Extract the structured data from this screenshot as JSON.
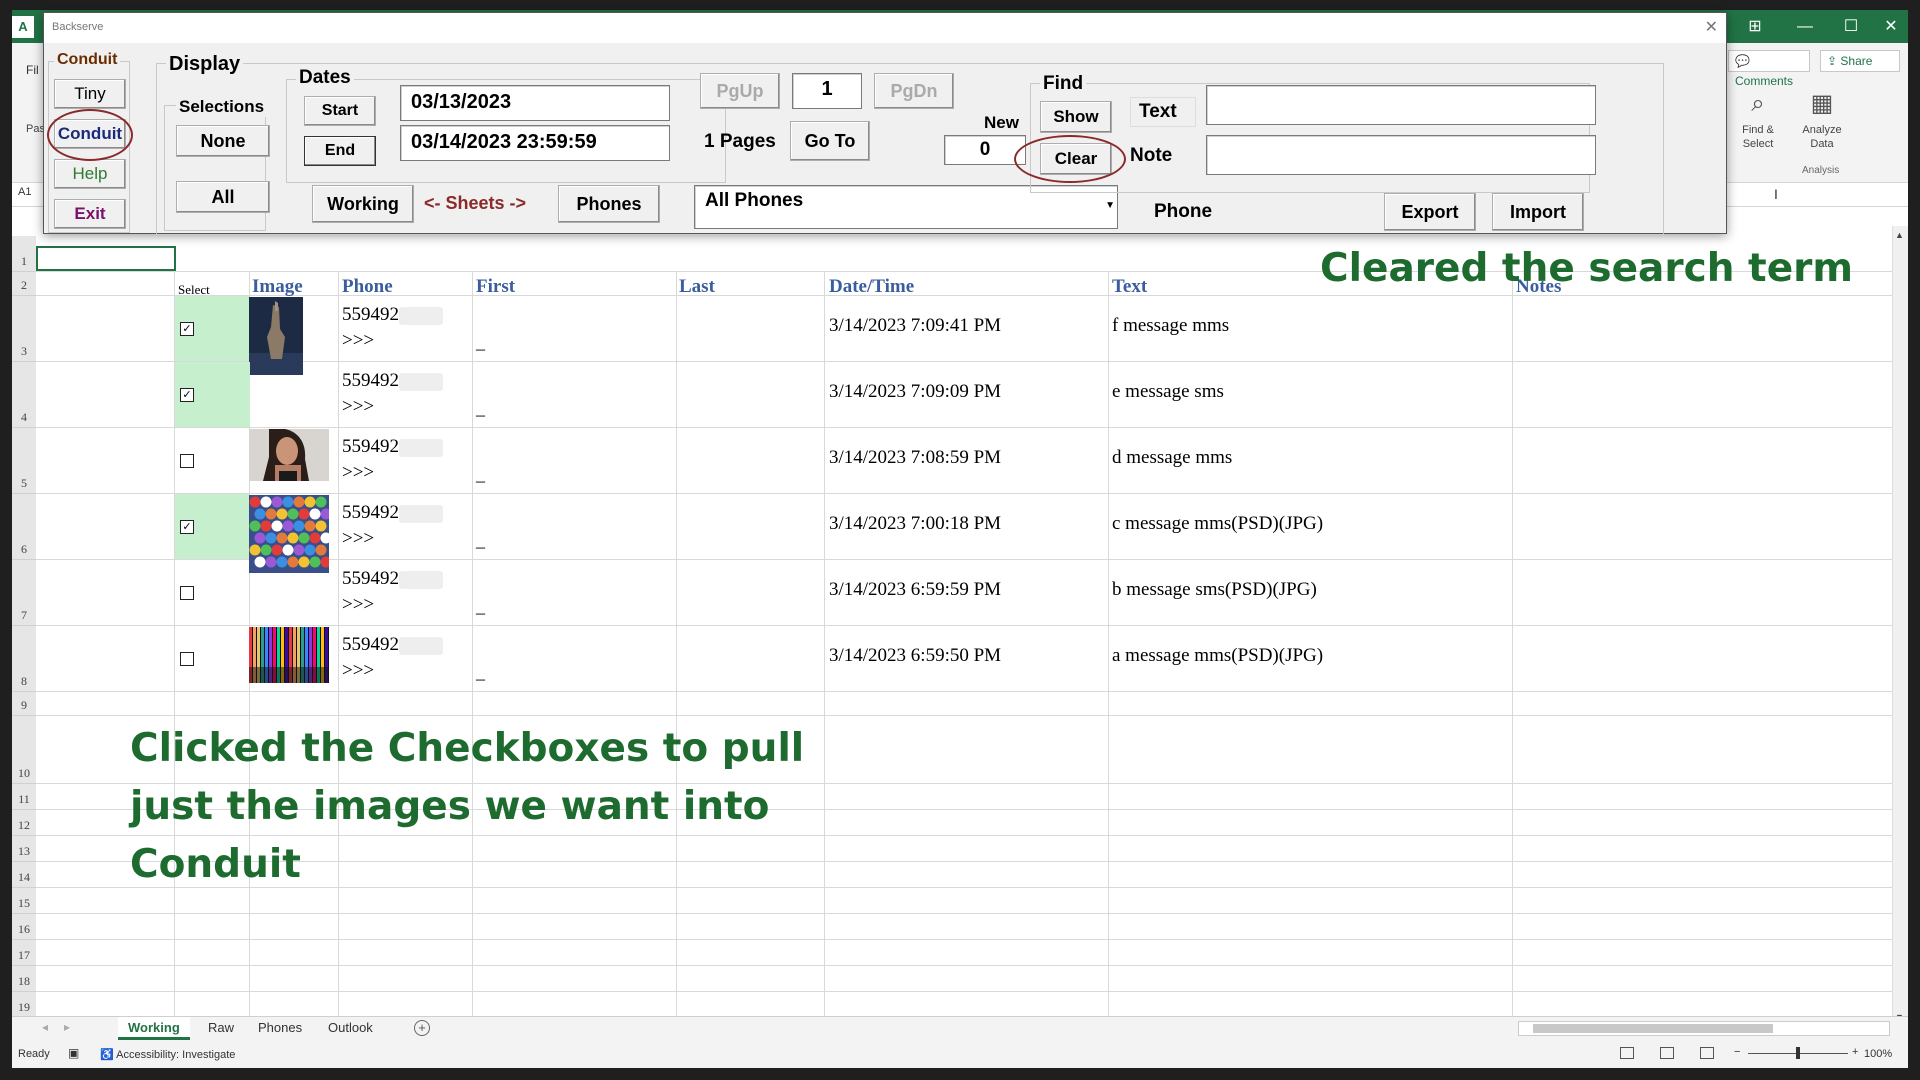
{
  "excel": {
    "app_letter": "A",
    "file_letter": "Fil",
    "paste_letter": "Pas",
    "comments": "Comments",
    "share": "Share",
    "find_select": "Find & Select",
    "analyze_data": "Analyze Data",
    "analysis_group": "Analysis",
    "name_box": "A1",
    "sheet_tabs": [
      "Working",
      "Raw",
      "Phones",
      "Outlook"
    ],
    "active_tab": "Working",
    "status_ready": "Ready",
    "status_accessibility": "Accessibility: Investigate",
    "zoom": "100%"
  },
  "dialog": {
    "title": "Backserve",
    "conduit_group": {
      "label": "Conduit",
      "tiny": "Tiny",
      "conduit": "Conduit",
      "help": "Help",
      "exit": "Exit"
    },
    "display_group": {
      "label": "Display",
      "selections_label": "Selections",
      "none": "None",
      "all": "All"
    },
    "dates_group": {
      "label": "Dates",
      "start": "Start",
      "end": "End",
      "start_value": "03/13/2023",
      "end_value": "03/14/2023 23:59:59"
    },
    "sheets": {
      "working": "Working",
      "arrows": "<- Sheets ->",
      "phones": "Phones"
    },
    "paging": {
      "pgup": "PgUp",
      "page_value": "1",
      "pgdn": "PgDn",
      "pages_label": "1 Pages",
      "goto": "Go To",
      "new_label": "New",
      "new_value": "0"
    },
    "phones_dropdown": "All Phones",
    "find_group": {
      "label": "Find",
      "show": "Show",
      "clear": "Clear",
      "text_label": "Text",
      "note_label": "Note",
      "text_value": "",
      "note_value": ""
    },
    "phone_label": "Phone",
    "export": "Export",
    "import": "Import"
  },
  "sheet": {
    "row_numbers": [
      "1",
      "2",
      "3",
      "4",
      "5",
      "6",
      "7",
      "8",
      "9",
      "10",
      "11",
      "12",
      "13",
      "14",
      "15",
      "16",
      "17",
      "18",
      "19"
    ],
    "headers": {
      "select": "Select",
      "image": "Image",
      "phone": "Phone",
      "first": "First",
      "last": "Last",
      "datetime": "Date/Time",
      "text": "Text",
      "notes": "Notes"
    },
    "rows": [
      {
        "checked": true,
        "image": "hand-sculpture",
        "phone": "559492",
        "arrow": ">>>",
        "first": "_",
        "datetime": "3/14/2023 7:09:41 PM",
        "text": "f message mms"
      },
      {
        "checked": true,
        "image": "",
        "phone": "559492",
        "arrow": ">>>",
        "first": "_",
        "datetime": "3/14/2023 7:09:09 PM",
        "text": "e message sms"
      },
      {
        "checked": false,
        "image": "portrait",
        "phone": "559492",
        "arrow": ">>>",
        "first": "_",
        "datetime": "3/14/2023 7:08:59 PM",
        "text": "d message mms"
      },
      {
        "checked": true,
        "image": "colored-balls",
        "phone": "559492",
        "arrow": ">>>",
        "first": "_",
        "datetime": "3/14/2023 7:00:18 PM",
        "text": "c message mms(PSD)(JPG)"
      },
      {
        "checked": false,
        "image": "",
        "phone": "559492",
        "arrow": ">>>",
        "first": "_",
        "datetime": "3/14/2023 6:59:59 PM",
        "text": "b message sms(PSD)(JPG)"
      },
      {
        "checked": false,
        "image": "rainbow-stripes",
        "phone": "559492",
        "arrow": ">>>",
        "first": "_",
        "datetime": "3/14/2023 6:59:50 PM",
        "text": "a message mms(PSD)(JPG)"
      }
    ]
  },
  "annotations": {
    "cleared": "Cleared the search term",
    "checkbox_line1": "Clicked the Checkboxes to pull",
    "checkbox_line2": "just the images we want into",
    "checkbox_line3": "Conduit"
  },
  "colors": {
    "excel_green": "#217346",
    "annotation_green": "#1e6b30",
    "header_blue": "#3b5c9e",
    "circle_red": "#8a2a2a",
    "selected_fill": "#c6efce"
  }
}
